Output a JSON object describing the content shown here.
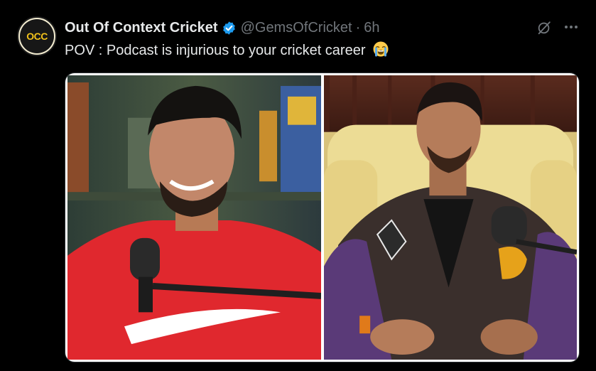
{
  "tweet": {
    "avatar": {
      "logo_text": "OCC"
    },
    "author": {
      "display_name": "Out Of Context Cricket",
      "handle": "@GemsOfCricket",
      "separator": "·",
      "time": "6h",
      "verified": true
    },
    "text": "POV : Podcast is injurious to your cricket career",
    "emoji": "crying-face",
    "icons": {
      "grok": "grok-icon",
      "more": "more-icon",
      "verified": "verified-badge-icon"
    },
    "colors": {
      "background": "#000000",
      "text": "#e7e9ea",
      "secondary": "#71767b",
      "verified": "#1d9bf0",
      "border": "#2f3336"
    },
    "media": {
      "layout": "side-by-side",
      "left_photo": "man-in-red-shirt-podcast",
      "right_photo": "man-in-varsity-jacket-podcast"
    }
  }
}
